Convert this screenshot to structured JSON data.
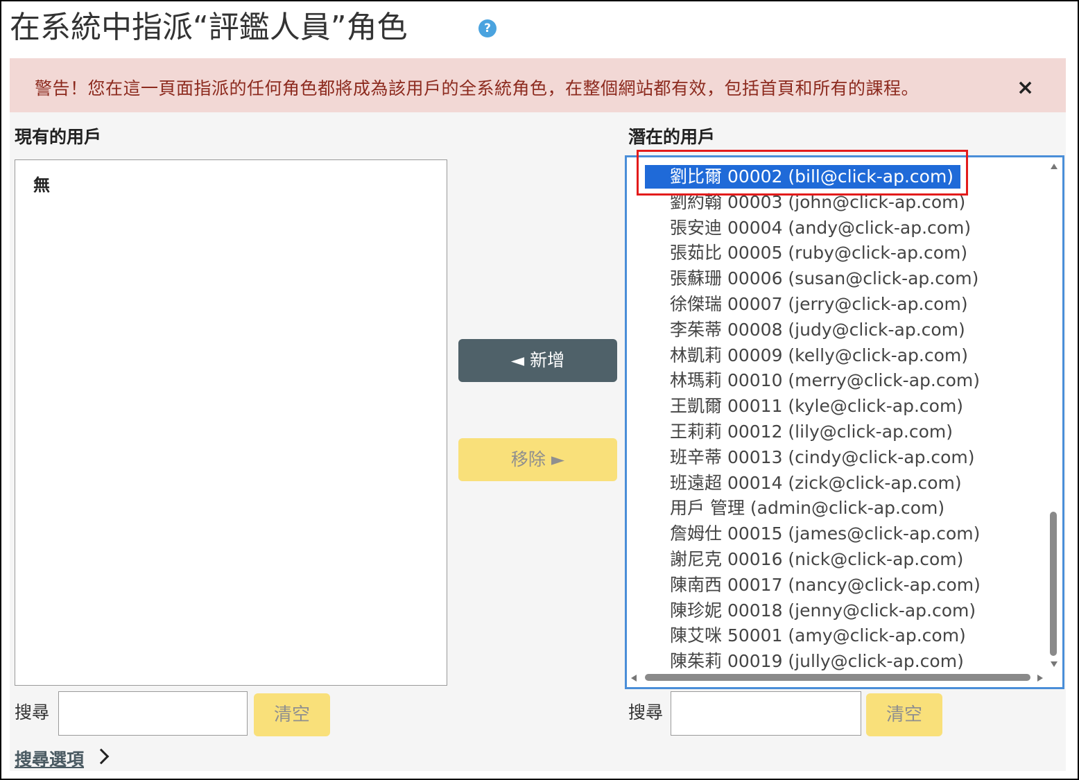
{
  "header": {
    "title": "在系統中指派“評鑑人員”角色",
    "help_icon": "question-circle-icon"
  },
  "alert": {
    "text": "警告！您在這一頁面指派的任何角色都將成為該用戶的全系統角色，在整個網站都有效，包括首頁和所有的課程。",
    "close_label": "×"
  },
  "existing": {
    "label": "現有的用戶",
    "items": [
      "無"
    ]
  },
  "actions": {
    "add_label": "◄ 新增",
    "remove_label": "移除 ►"
  },
  "potential": {
    "label": "潛在的用戶",
    "selected_index": 0,
    "items": [
      "劉比爾 00002 (bill@click-ap.com)",
      "劉約翰 00003 (john@click-ap.com)",
      "張安迪 00004 (andy@click-ap.com)",
      "張茹比 00005 (ruby@click-ap.com)",
      "張蘇珊 00006 (susan@click-ap.com)",
      "徐傑瑞 00007 (jerry@click-ap.com)",
      "李茱蒂 00008 (judy@click-ap.com)",
      "林凱莉 00009 (kelly@click-ap.com)",
      "林瑪莉 00010 (merry@click-ap.com)",
      "王凱爾 00011 (kyle@click-ap.com)",
      "王莉莉 00012 (lily@click-ap.com)",
      "班辛蒂 00013 (cindy@click-ap.com)",
      "班遠超 00014 (zick@click-ap.com)",
      "用戶 管理 (admin@click-ap.com)",
      "詹姆仕 00015 (james@click-ap.com)",
      "謝尼克 00016 (nick@click-ap.com)",
      "陳南西 00017 (nancy@click-ap.com)",
      "陳珍妮 00018 (jenny@click-ap.com)",
      "陳艾咪 50001 (amy@click-ap.com)",
      "陳茱莉 00019 (jully@click-ap.com)"
    ]
  },
  "search": {
    "label": "搜尋",
    "clear_label": "清空",
    "left_value": "",
    "right_value": ""
  },
  "search_options": {
    "label": "搜尋選項"
  },
  "colors": {
    "alert_bg": "#f2d8d5",
    "alert_text": "#8c2a1e",
    "add_button": "#4f6169",
    "clear_button": "#f9e07a",
    "selection": "#1f6ad8",
    "list_border": "#4a8ed8",
    "highlight": "#e31b1b"
  }
}
